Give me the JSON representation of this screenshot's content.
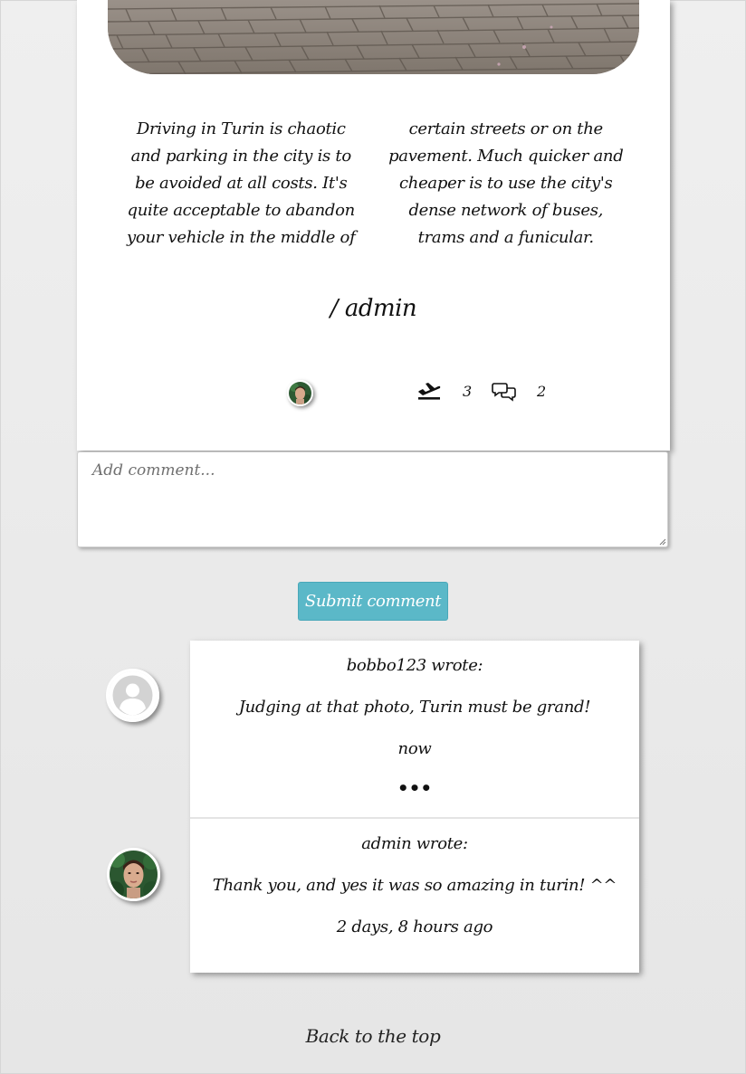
{
  "post": {
    "body": "Driving in Turin is chaotic and parking in the city is to be avoided at all costs. It's quite acceptable to abandon your vehicle in the middle of certain streets or on the pavement. Much quicker and cheaper is to use the city's dense network of buses, trams and a funicular.",
    "author": "/ admin",
    "meta": {
      "avatar_icon": "user-avatar-photo",
      "trips_icon": "plane-departure-icon",
      "trips_count": "3",
      "comments_icon": "speech-bubbles-icon",
      "comments_count": "2"
    }
  },
  "comment_form": {
    "placeholder": "Add comment...",
    "value": "",
    "submit_label": "Submit comment"
  },
  "comments": [
    {
      "author_line": "bobbo123 wrote:",
      "text": "Judging at that photo, Turin must be grand!",
      "time": "now",
      "more": "•••",
      "avatar": "default-user-icon"
    },
    {
      "author_line": "admin wrote:",
      "text": "Thank you, and yes it was so amazing in turin! ^^",
      "time": "2 days, 8 hours ago",
      "avatar": "admin-photo"
    }
  ],
  "footer": {
    "back_to_top": "Back to the top"
  },
  "colors": {
    "accent": "#5bb8c8",
    "background": "#e9e9e9",
    "card": "#ffffff"
  }
}
